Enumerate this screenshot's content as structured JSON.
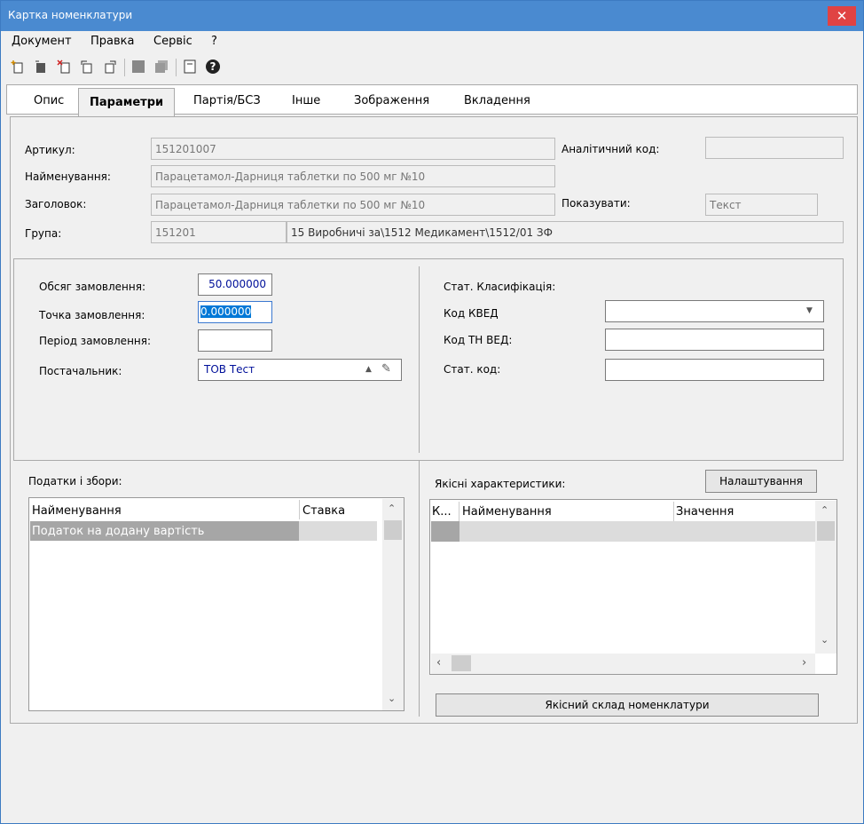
{
  "window": {
    "title": "Картка номенклатури",
    "close": "✕"
  },
  "menu": [
    "Документ",
    "Правка",
    "Сервіс",
    "?"
  ],
  "toolbar": {
    "help": "?"
  },
  "tabs": [
    "Опис",
    "Параметри",
    "Партія/БСЗ",
    "Інше",
    "Зображення",
    "Вкладення"
  ],
  "header": {
    "article_label": "Артикул:",
    "article_value": "151201007",
    "name_label": "Найменування:",
    "name_value": "Парацетамол-Дарниця таблетки по 500 мг №10",
    "heading_label": "Заголовок:",
    "heading_value": "Парацетамол-Дарниця таблетки по 500 мг №10",
    "group_label": "Група:",
    "group_code": "151201",
    "group_path": "15 Виробничі за\\1512 Медикамент\\1512/01 ЗФ",
    "analytic_label": "Аналітичний код:",
    "analytic_value": "",
    "show_label": "Показувати:",
    "show_value": "Текст"
  },
  "order": {
    "volume_label": "Обсяг замовлення:",
    "volume_value": "50.000000",
    "point_label": "Точка замовлення:",
    "point_value": "0.000000",
    "period_label": "Період замовлення:",
    "period_value": "",
    "supplier_label": "Постачальник:",
    "supplier_value": "ТОВ Тест"
  },
  "stat": {
    "title": "Стат. Класифікація:",
    "kved_label": "Код КВЕД",
    "kved_value": "",
    "tnved_label": "Код ТН ВЕД:",
    "tnved_value": "",
    "code_label": "Стат. код:",
    "code_value": ""
  },
  "taxes": {
    "title": "Податки і збори:",
    "columns": [
      "Найменування",
      "Ставка"
    ],
    "rows": [
      [
        "Податок на додану вартість",
        ""
      ]
    ]
  },
  "quality": {
    "title": "Якісні характеристики:",
    "settings_button": "Налаштування",
    "columns": [
      "К...",
      "Найменування",
      "Значення"
    ],
    "composition_button": "Якісний склад номенклатури"
  }
}
